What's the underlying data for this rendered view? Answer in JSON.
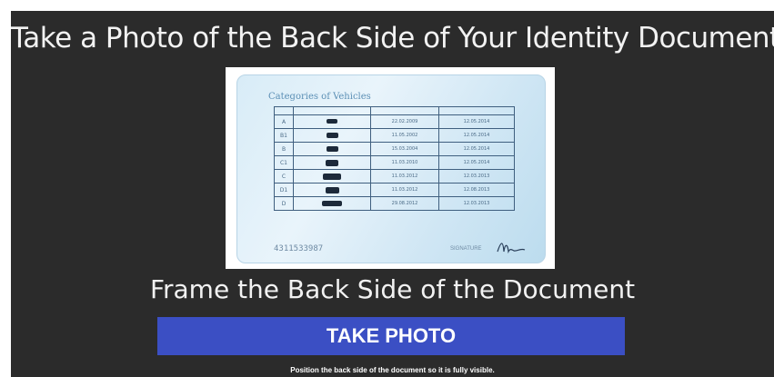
{
  "header": {
    "title": "Take a Photo of the Back Side of Your Identity Document"
  },
  "document_preview": {
    "heading": "Categories of Vehicles",
    "columns": [
      "",
      "",
      "",
      ""
    ],
    "rows": [
      {
        "code": "A",
        "vehicle_icon": "motorcycle-icon",
        "valid_from": "22.02.2009",
        "valid_to": "12.05.2014"
      },
      {
        "code": "B1",
        "vehicle_icon": "car-icon",
        "valid_from": "11.05.2002",
        "valid_to": "12.05.2014"
      },
      {
        "code": "B",
        "vehicle_icon": "car-icon",
        "valid_from": "15.03.2004",
        "valid_to": "12.05.2014"
      },
      {
        "code": "C1",
        "vehicle_icon": "truck-icon",
        "valid_from": "11.03.2010",
        "valid_to": "12.05.2014"
      },
      {
        "code": "C",
        "vehicle_icon": "truck-icon",
        "valid_from": "11.03.2012",
        "valid_to": "12.03.2013"
      },
      {
        "code": "D1",
        "vehicle_icon": "van-icon",
        "valid_from": "11.03.2012",
        "valid_to": "12.08.2013"
      },
      {
        "code": "D",
        "vehicle_icon": "bus-icon",
        "valid_from": "29.08.2012",
        "valid_to": "12.03.2013"
      }
    ],
    "document_number": "4311533987",
    "signature_label": "SIGNATURE"
  },
  "instruction": {
    "subtitle": "Frame the Back Side of the Document"
  },
  "actions": {
    "take_photo_label": "TAKE PHOTO"
  },
  "footer": {
    "hint": "Position the back side of the document so it is fully visible."
  },
  "colors": {
    "background": "#2b2b2b",
    "button": "#3b4fc4",
    "text": "#f2f2f2"
  }
}
